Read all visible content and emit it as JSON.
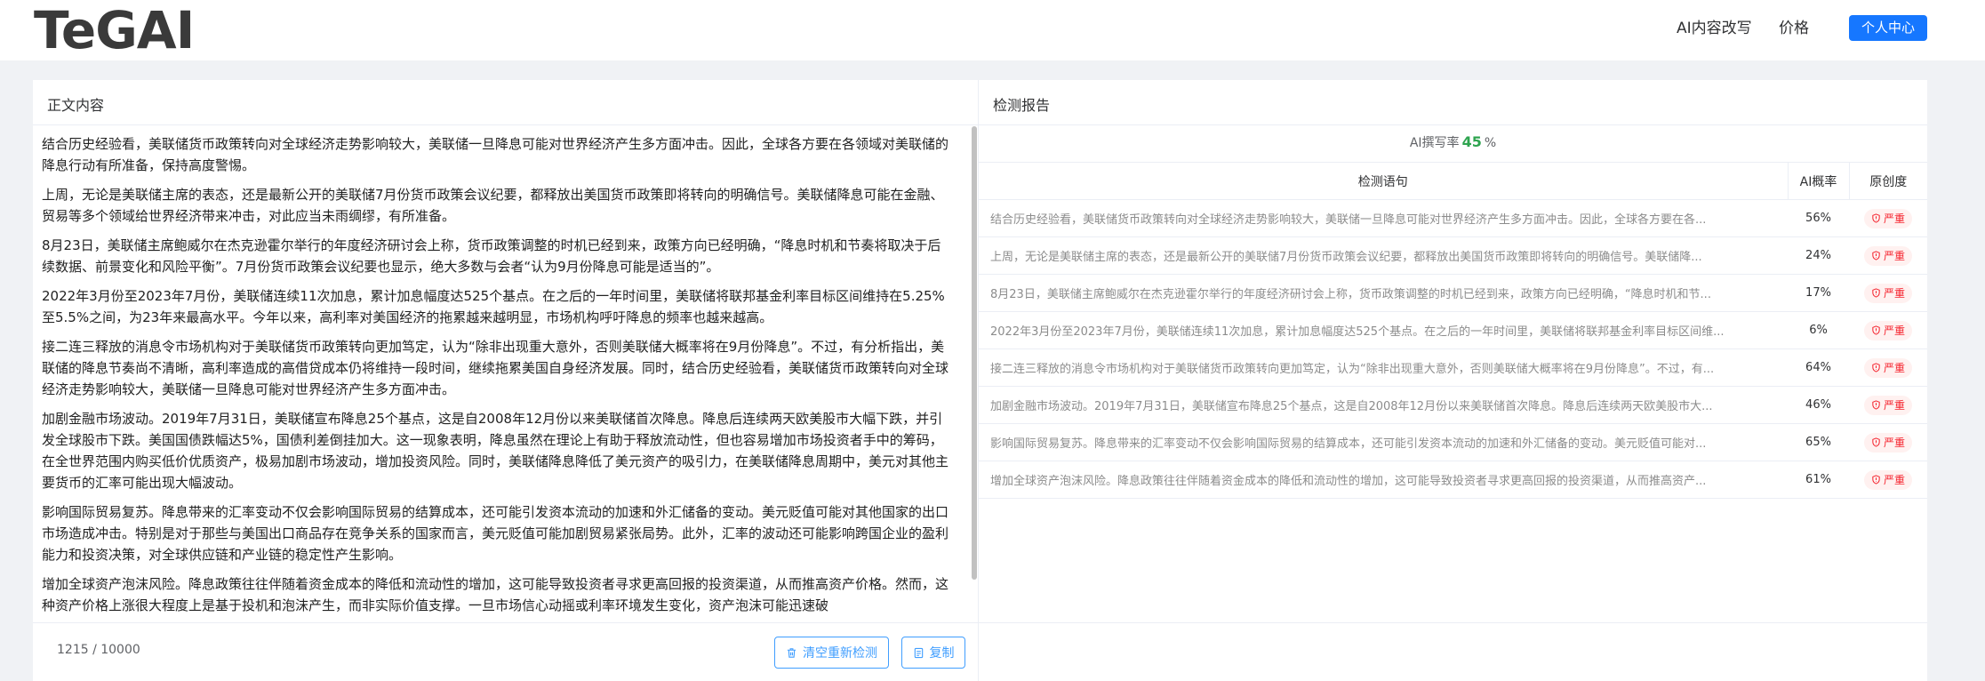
{
  "header": {
    "logo": "TeGAI",
    "nav_rewrite": "AI内容改写",
    "nav_price": "价格",
    "user_center": "个人中心"
  },
  "left_panel": {
    "title": "正文内容",
    "paragraphs": [
      "结合历史经验看，美联储货币政策转向对全球经济走势影响较大，美联储一旦降息可能对世界经济产生多方面冲击。因此，全球各方要在各领域对美联储的降息行动有所准备，保持高度警惕。",
      "上周，无论是美联储主席的表态，还是最新公开的美联储7月份货币政策会议纪要，都释放出美国货币政策即将转向的明确信号。美联储降息可能在金融、贸易等多个领域给世界经济带来冲击，对此应当未雨绸缪，有所准备。",
      "8月23日，美联储主席鲍威尔在杰克逊霍尔举行的年度经济研讨会上称，货币政策调整的时机已经到来，政策方向已经明确，“降息时机和节奏将取决于后续数据、前景变化和风险平衡”。7月份货币政策会议纪要也显示，绝大多数与会者“认为9月份降息可能是适当的”。",
      "2022年3月份至2023年7月份，美联储连续11次加息，累计加息幅度达525个基点。在之后的一年时间里，美联储将联邦基金利率目标区间维持在5.25%至5.5%之间，为23年来最高水平。今年以来，高利率对美国经济的拖累越来越明显，市场机构呼吁降息的频率也越来越高。",
      "接二连三释放的消息令市场机构对于美联储货币政策转向更加笃定，认为“除非出现重大意外，否则美联储大概率将在9月份降息”。不过，有分析指出，美联储的降息节奏尚不清晰，高利率造成的高借贷成本仍将维持一段时间，继续拖累美国自身经济发展。同时，结合历史经验看，美联储货币政策转向对全球经济走势影响较大，美联储一旦降息可能对世界经济产生多方面冲击。",
      "加剧金融市场波动。2019年7月31日，美联储宣布降息25个基点，这是自2008年12月份以来美联储首次降息。降息后连续两天欧美股市大幅下跌，并引发全球股市下跌。美国国债跌幅达5%，国债利差倒挂加大。这一现象表明，降息虽然在理论上有助于释放流动性，但也容易增加市场投资者手中的筹码，在全世界范围内购买低价优质资产，极易加剧市场波动，增加投资风险。同时，美联储降息降低了美元资产的吸引力，在美联储降息周期中，美元对其他主要货币的汇率可能出现大幅波动。",
      "影响国际贸易复苏。降息带来的汇率变动不仅会影响国际贸易的结算成本，还可能引发资本流动的加速和外汇储备的变动。美元贬值可能对其他国家的出口市场造成冲击。特别是对于那些与美国出口商品存在竞争关系的国家而言，美元贬值可能加剧贸易紧张局势。此外，汇率的波动还可能影响跨国企业的盈利能力和投资决策，对全球供应链和产业链的稳定性产生影响。",
      "增加全球资产泡沫风险。降息政策往往伴随着资金成本的降低和流动性的增加，这可能导致投资者寻求更高回报的投资渠道，从而推高资产价格。然而，这种资产价格上涨很大程度上是基于投机和泡沫产生，而非实际价值支撑。一旦市场信心动摇或利率环境发生变化，资产泡沫可能迅速破"
    ],
    "counter": "1215 / 10000",
    "clear_button": "清空重新检测",
    "copy_button": "复制"
  },
  "right_panel": {
    "title": "检测报告",
    "ai_rate_label": "AI撰写率",
    "ai_rate_value": "45",
    "ai_rate_unit": "%",
    "columns": [
      "检测语句",
      "AI概率",
      "原创度"
    ],
    "rows": [
      {
        "sentence": "结合历史经验看，美联储货币政策转向对全球经济走势影响较大，美联储一旦降息可能对世界经济产生多方面冲击。因此，全球各方要在各...",
        "prob": "56%",
        "orig": "严重"
      },
      {
        "sentence": "上周，无论是美联储主席的表态，还是最新公开的美联储7月份货币政策会议纪要，都释放出美国货币政策即将转向的明确信号。美联储降...",
        "prob": "24%",
        "orig": "严重"
      },
      {
        "sentence": "8月23日，美联储主席鲍威尔在杰克逊霍尔举行的年度经济研讨会上称，货币政策调整的时机已经到来，政策方向已经明确，“降息时机和节...",
        "prob": "17%",
        "orig": "严重"
      },
      {
        "sentence": "2022年3月份至2023年7月份，美联储连续11次加息，累计加息幅度达525个基点。在之后的一年时间里，美联储将联邦基金利率目标区间维...",
        "prob": "6%",
        "orig": "严重"
      },
      {
        "sentence": "接二连三释放的消息令市场机构对于美联储货币政策转向更加笃定，认为“除非出现重大意外，否则美联储大概率将在9月份降息”。不过，有...",
        "prob": "64%",
        "orig": "严重"
      },
      {
        "sentence": "加剧金融市场波动。2019年7月31日，美联储宣布降息25个基点，这是自2008年12月份以来美联储首次降息。降息后连续两天欧美股市大...",
        "prob": "46%",
        "orig": "严重"
      },
      {
        "sentence": "影响国际贸易复苏。降息带来的汇率变动不仅会影响国际贸易的结算成本，还可能引发资本流动的加速和外汇储备的变动。美元贬值可能对...",
        "prob": "65%",
        "orig": "严重"
      },
      {
        "sentence": "增加全球资产泡沫风险。降息政策往往伴随着资金成本的降低和流动性的增加，这可能导致投资者寻求更高回报的投资渠道，从而推高资产...",
        "prob": "61%",
        "orig": "严重"
      }
    ]
  },
  "colors": {
    "primary": "#1677ff",
    "link_blue": "#409eff",
    "ai_rate_green": "#2ea44f",
    "tag_red": "#f5222d",
    "tag_bg": "#fff1f0"
  },
  "icons": {
    "clear": "trash-icon",
    "copy": "copy-icon",
    "tag": "shield-icon"
  }
}
